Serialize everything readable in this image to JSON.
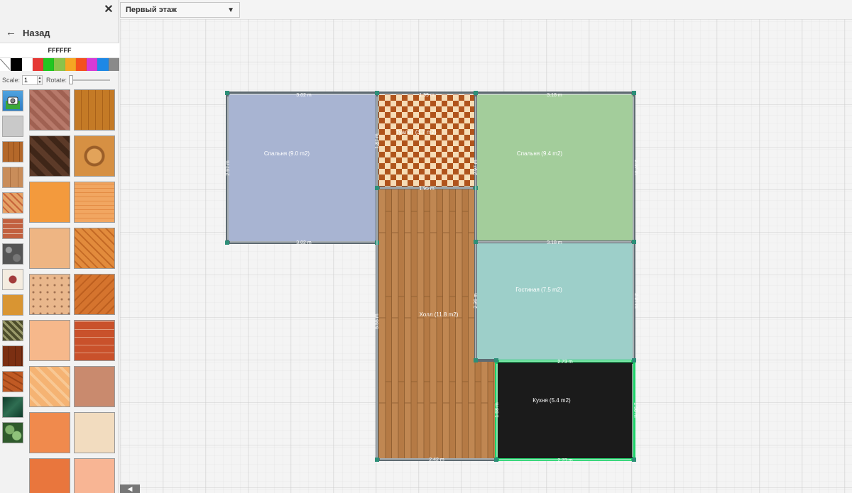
{
  "sidebar": {
    "back_label": "Назад",
    "hex_value": "FFFFFF",
    "swatches": [
      "none",
      "#000000",
      "#ffffff",
      "#e53935",
      "#21c621",
      "#8bc34a",
      "#f5a623",
      "#f4511e",
      "#d63ad6",
      "#1e88e5",
      "#8a8a8a"
    ],
    "scale_label": "Scale:",
    "scale_value": "1",
    "rotate_label": "Rotate:"
  },
  "toolbar": {
    "floor_label": "Первый этаж"
  },
  "rooms": [
    {
      "name": "Спальня (9.0 m2)",
      "label": "Спальня (9.0 m2)"
    },
    {
      "name": "Туалет (3.7 m2)",
      "label": "Туалет (3.7 m2)"
    },
    {
      "name": "Спальня (9.4 m2)",
      "label": "Спальня (9.4 m2)"
    },
    {
      "name": "Холл (11.8 m2)",
      "label": "Холл (11.8 m2)"
    },
    {
      "name": "Гостиная (7.5 m2)",
      "label": "Гостиная (7.5 m2)"
    },
    {
      "name": "Кухня (5.4 m2)",
      "label": "Кухня (5.4 m2)"
    }
  ],
  "dimensions": {
    "bedroom1_top": "3.02 m",
    "bedroom1_bottom": "3.02 m",
    "bedroom1_left": "2.97 m",
    "toilet_top": "1.99 m",
    "toilet_bottom": "1.95 m",
    "toilet_left": "1.87 m",
    "bedroom2_top": "3.18 m",
    "bedroom2_bottom": "3.18 m",
    "bedroom2_left": "2.97 m",
    "bedroom2_right": "2.97 m",
    "living_left": "2.36 m",
    "living_right": "2.37 m",
    "hall_left": "5.55 m",
    "hall_bottom": "2.42 m",
    "kitchen_top": "2.73 m",
    "kitchen_bottom": "2.73 m",
    "kitchen_left": "1.98 m",
    "kitchen_right": "1.98 m"
  },
  "colors": {
    "wall": "#5f6b72",
    "selected_wall": "#1fd16a",
    "bedroom1": "#a8b4d2",
    "bedroom2": "#a3cd9b",
    "living": "#9dcfc9",
    "kitchen": "#1b1b1b"
  }
}
